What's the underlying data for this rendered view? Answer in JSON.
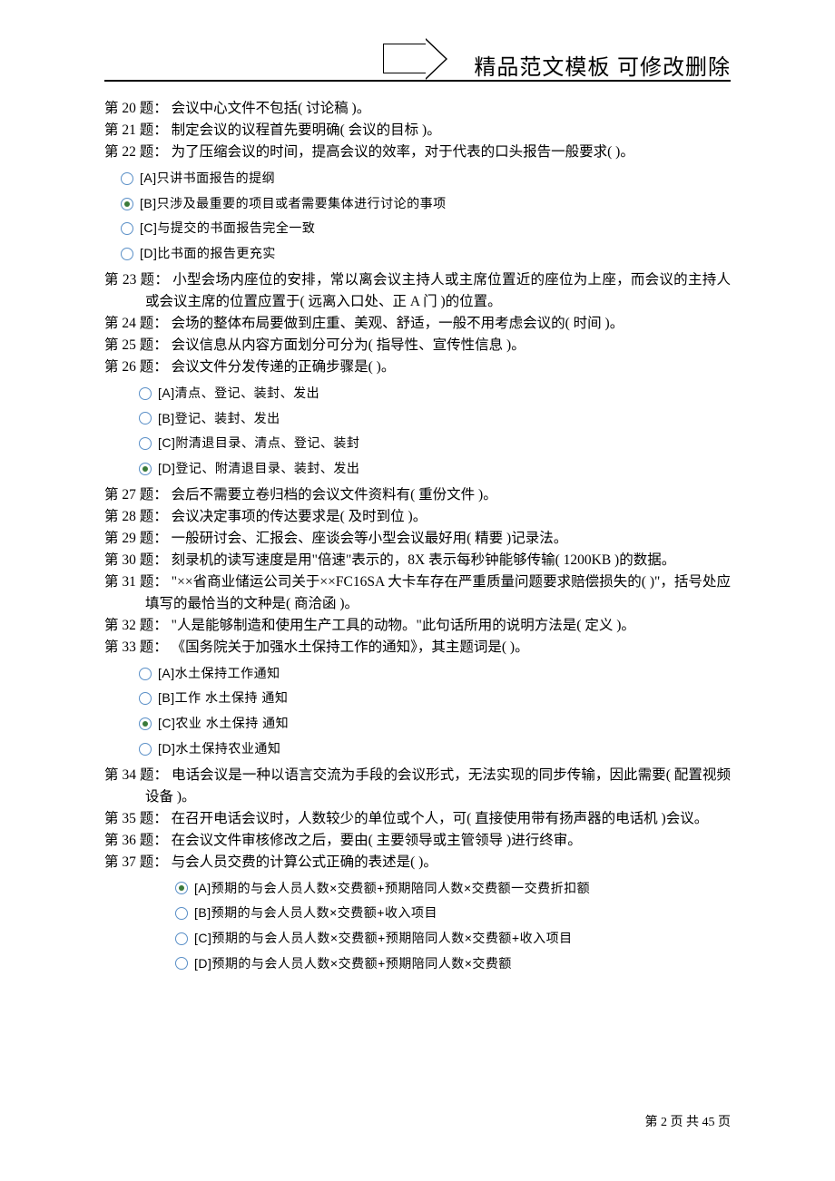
{
  "header": {
    "title": "精品范文模板  可修改删除"
  },
  "questions": {
    "q20": "第 20 题：  会议中心文件不包括( 讨论稿 )。",
    "q21": "第 21 题：  制定会议的议程首先要明确( 会议的目标 )。",
    "q22": "第 22 题：  为了压缩会议的时间，提高会议的效率，对于代表的口头报告一般要求(  )。",
    "q22_opts": {
      "a": "[A]只讲书面报告的提纲",
      "b": "[B]只涉及最重要的项目或者需要集体进行讨论的事项",
      "c": "[C]与提交的书面报告完全一致",
      "d": "[D]比书面的报告更充实"
    },
    "q23": "第 23 题：  小型会场内座位的安排，常以离会议主持人或主席位置近的座位为上座，而会议的主持人或会议主席的位置应置于( 远离入口处、正 A 门 )的位置。",
    "q24": "第 24 题：  会场的整体布局要做到庄重、美观、舒适，一般不用考虑会议的( 时间 )。",
    "q25": "第 25 题：  会议信息从内容方面划分可分为( 指导性、宣传性信息 )。",
    "q26": "第 26 题：  会议文件分发传递的正确步骤是(  )。",
    "q26_opts": {
      "a": "[A]清点、登记、装封、发出",
      "b": "[B]登记、装封、发出",
      "c": "[C]附清退目录、清点、登记、装封",
      "d": "[D]登记、附清退目录、装封、发出"
    },
    "q27": "第 27 题：  会后不需要立卷归档的会议文件资料有( 重份文件 )。",
    "q28": "第 28 题：  会议决定事项的传达要求是( 及时到位 )。",
    "q29": "第 29 题：  一般研讨会、汇报会、座谈会等小型会议最好用( 精要 )记录法。",
    "q30": "第 30 题：  刻录机的读写速度是用\"倍速\"表示的，8X 表示每秒钟能够传输( 1200KB )的数据。",
    "q31": "第 31 题：  \"××省商业储运公司关于××FC16SA 大卡车存在严重质量问题要求赔偿损失的(  )\"，括号处应填写的最恰当的文种是( 商洽函 )。",
    "q32": "第 32 题：  \"人是能够制造和使用生产工具的动物。\"此句话所用的说明方法是( 定义 )。",
    "q33": "第 33 题：  《国务院关于加强水土保持工作的通知》，其主题词是(  )。",
    "q33_opts": {
      "a": "[A]水土保持工作通知",
      "b": "[B]工作  水土保持  通知",
      "c": "[C]农业  水土保持  通知",
      "d": "[D]水土保持农业通知"
    },
    "q34": "第 34 题：  电话会议是一种以语言交流为手段的会议形式，无法实现的同步传输，因此需要( 配置视频设备 )。",
    "q35": "第 35 题：  在召开电话会议时，人数较少的单位或个人，可( 直接使用带有扬声器的电话机 )会议。",
    "q36": "第 36 题：  在会议文件审核修改之后，要由( 主要领导或主管领导 )进行终审。",
    "q37": "第 37 题：  与会人员交费的计算公式正确的表述是(  )。",
    "q37_opts": {
      "a": "[A]预期的与会人员人数×交费额+预期陪同人数×交费额一交费折扣额",
      "b": "[B]预期的与会人员人数×交费额+收入项目",
      "c": "[C]预期的与会人员人数×交费额+预期陪同人数×交费额+收入项目",
      "d": "[D]预期的与会人员人数×交费额+预期陪同人数×交费额"
    }
  },
  "footer": {
    "text": "第 2 页 共 45 页"
  }
}
